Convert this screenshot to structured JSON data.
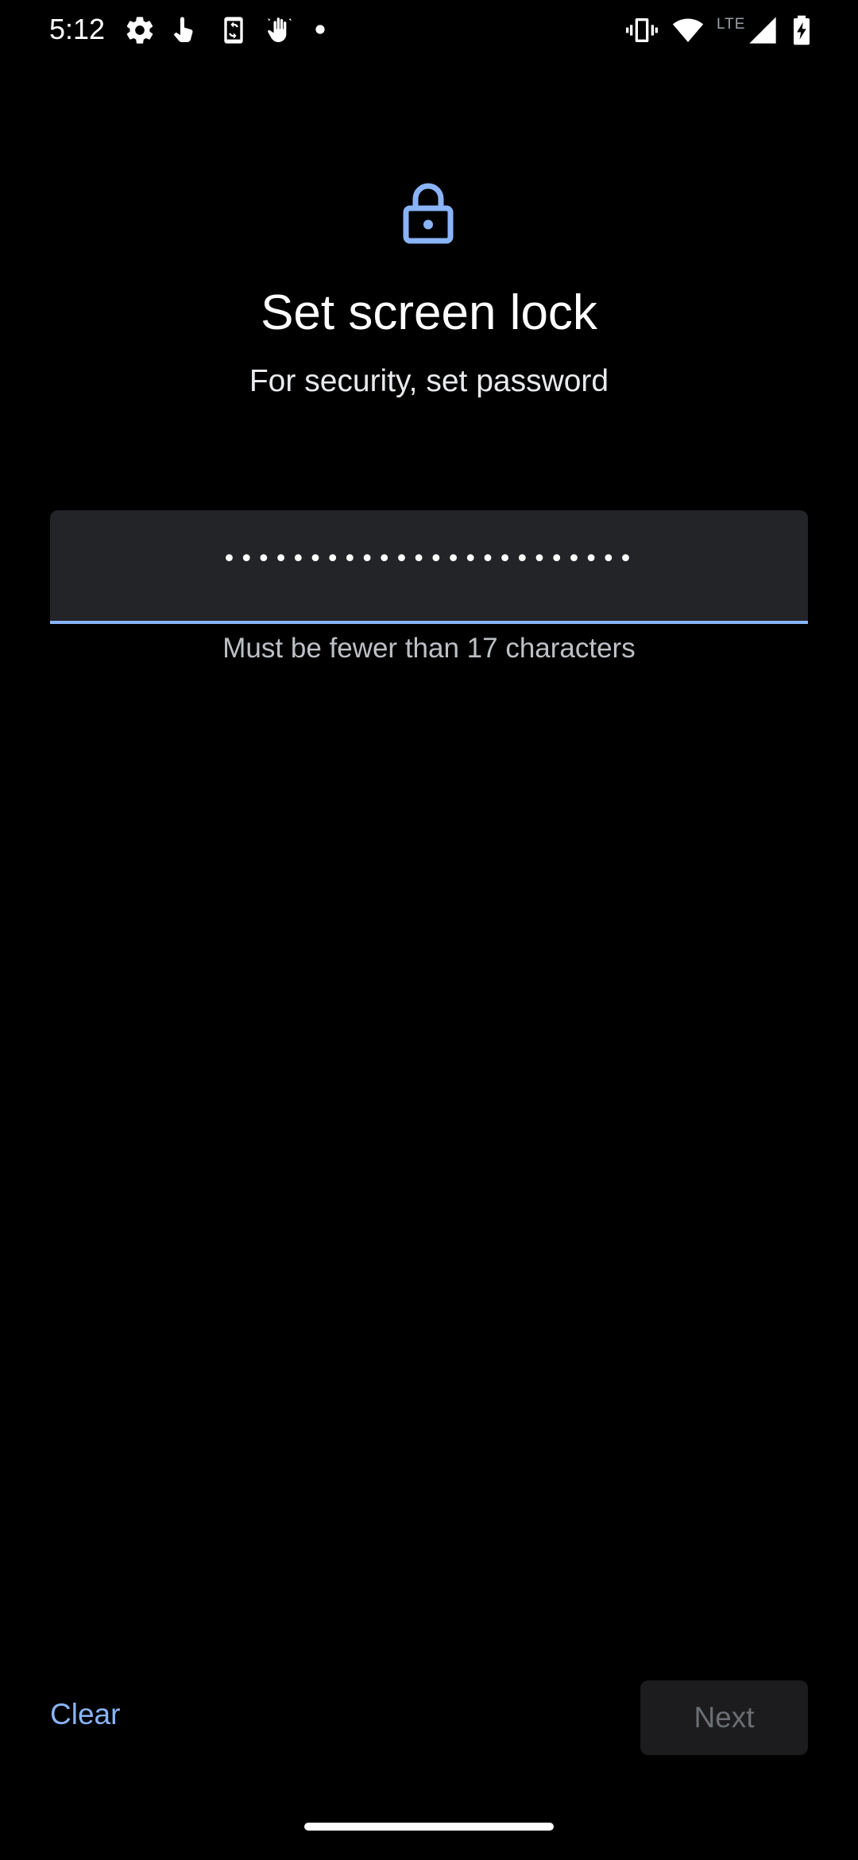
{
  "status_bar": {
    "time": "5:12",
    "network_label": "LTE",
    "left_icons": [
      "settings-icon",
      "touch-gesture-icon",
      "phone-sync-icon",
      "hand-wave-icon",
      "notification-dot-icon"
    ],
    "right_icons": [
      "vibrate-icon",
      "wifi-icon",
      "cell-signal-icon",
      "battery-charging-icon"
    ]
  },
  "header": {
    "icon": "lock-icon",
    "title": "Set screen lock",
    "subtitle": "For security, set password"
  },
  "password": {
    "masked_value": "••••••••••••••••••••••••",
    "helper_text": "Must be fewer than 17 characters"
  },
  "actions": {
    "clear_label": "Clear",
    "next_label": "Next"
  },
  "colors": {
    "accent": "#8ab4f8",
    "background": "#000000",
    "field_background": "#222428",
    "disabled_button": "#1c1c1e"
  }
}
